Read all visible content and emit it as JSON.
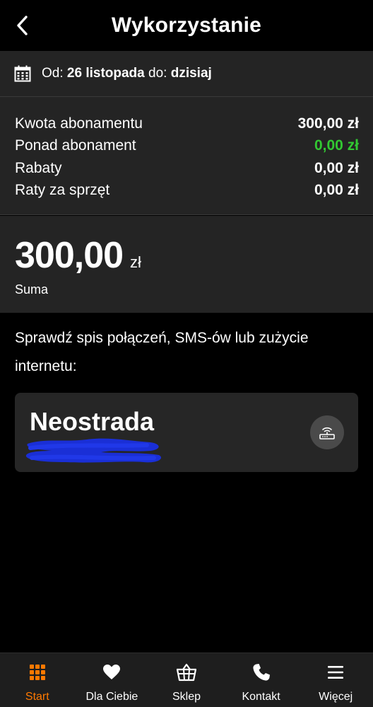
{
  "header": {
    "title": "Wykorzystanie"
  },
  "date_range": {
    "from_label": "Od:",
    "from_value": "26 listopada",
    "to_label": "do:",
    "to_value": "dzisiaj"
  },
  "breakdown": {
    "rows": [
      {
        "label": "Kwota abonamentu",
        "value": "300,00 zł",
        "color": "#ffffff"
      },
      {
        "label": "Ponad abonament",
        "value": "0,00 zł",
        "color": "#32c832"
      },
      {
        "label": "Rabaty",
        "value": "0,00 zł",
        "color": "#ffffff"
      },
      {
        "label": "Raty za sprzęt",
        "value": "0,00 zł",
        "color": "#ffffff"
      }
    ]
  },
  "total": {
    "amount": "300,00",
    "currency": "zł",
    "label": "Suma"
  },
  "info_text": "Sprawdź spis połączeń, SMS-ów lub zużycie internetu:",
  "service_card": {
    "title": "Neostrada",
    "icon": "router-icon"
  },
  "bottom_nav": {
    "items": [
      {
        "label": "Start",
        "icon": "grid-icon",
        "active": true
      },
      {
        "label": "Dla Ciebie",
        "icon": "heart-icon",
        "active": false
      },
      {
        "label": "Sklep",
        "icon": "basket-icon",
        "active": false
      },
      {
        "label": "Kontakt",
        "icon": "phone-icon",
        "active": false
      },
      {
        "label": "Więcej",
        "icon": "menu-icon",
        "active": false
      }
    ]
  },
  "colors": {
    "accent": "#ff7900",
    "positive": "#32c832",
    "panel": "#242424",
    "redaction": "#1a2fd6"
  }
}
